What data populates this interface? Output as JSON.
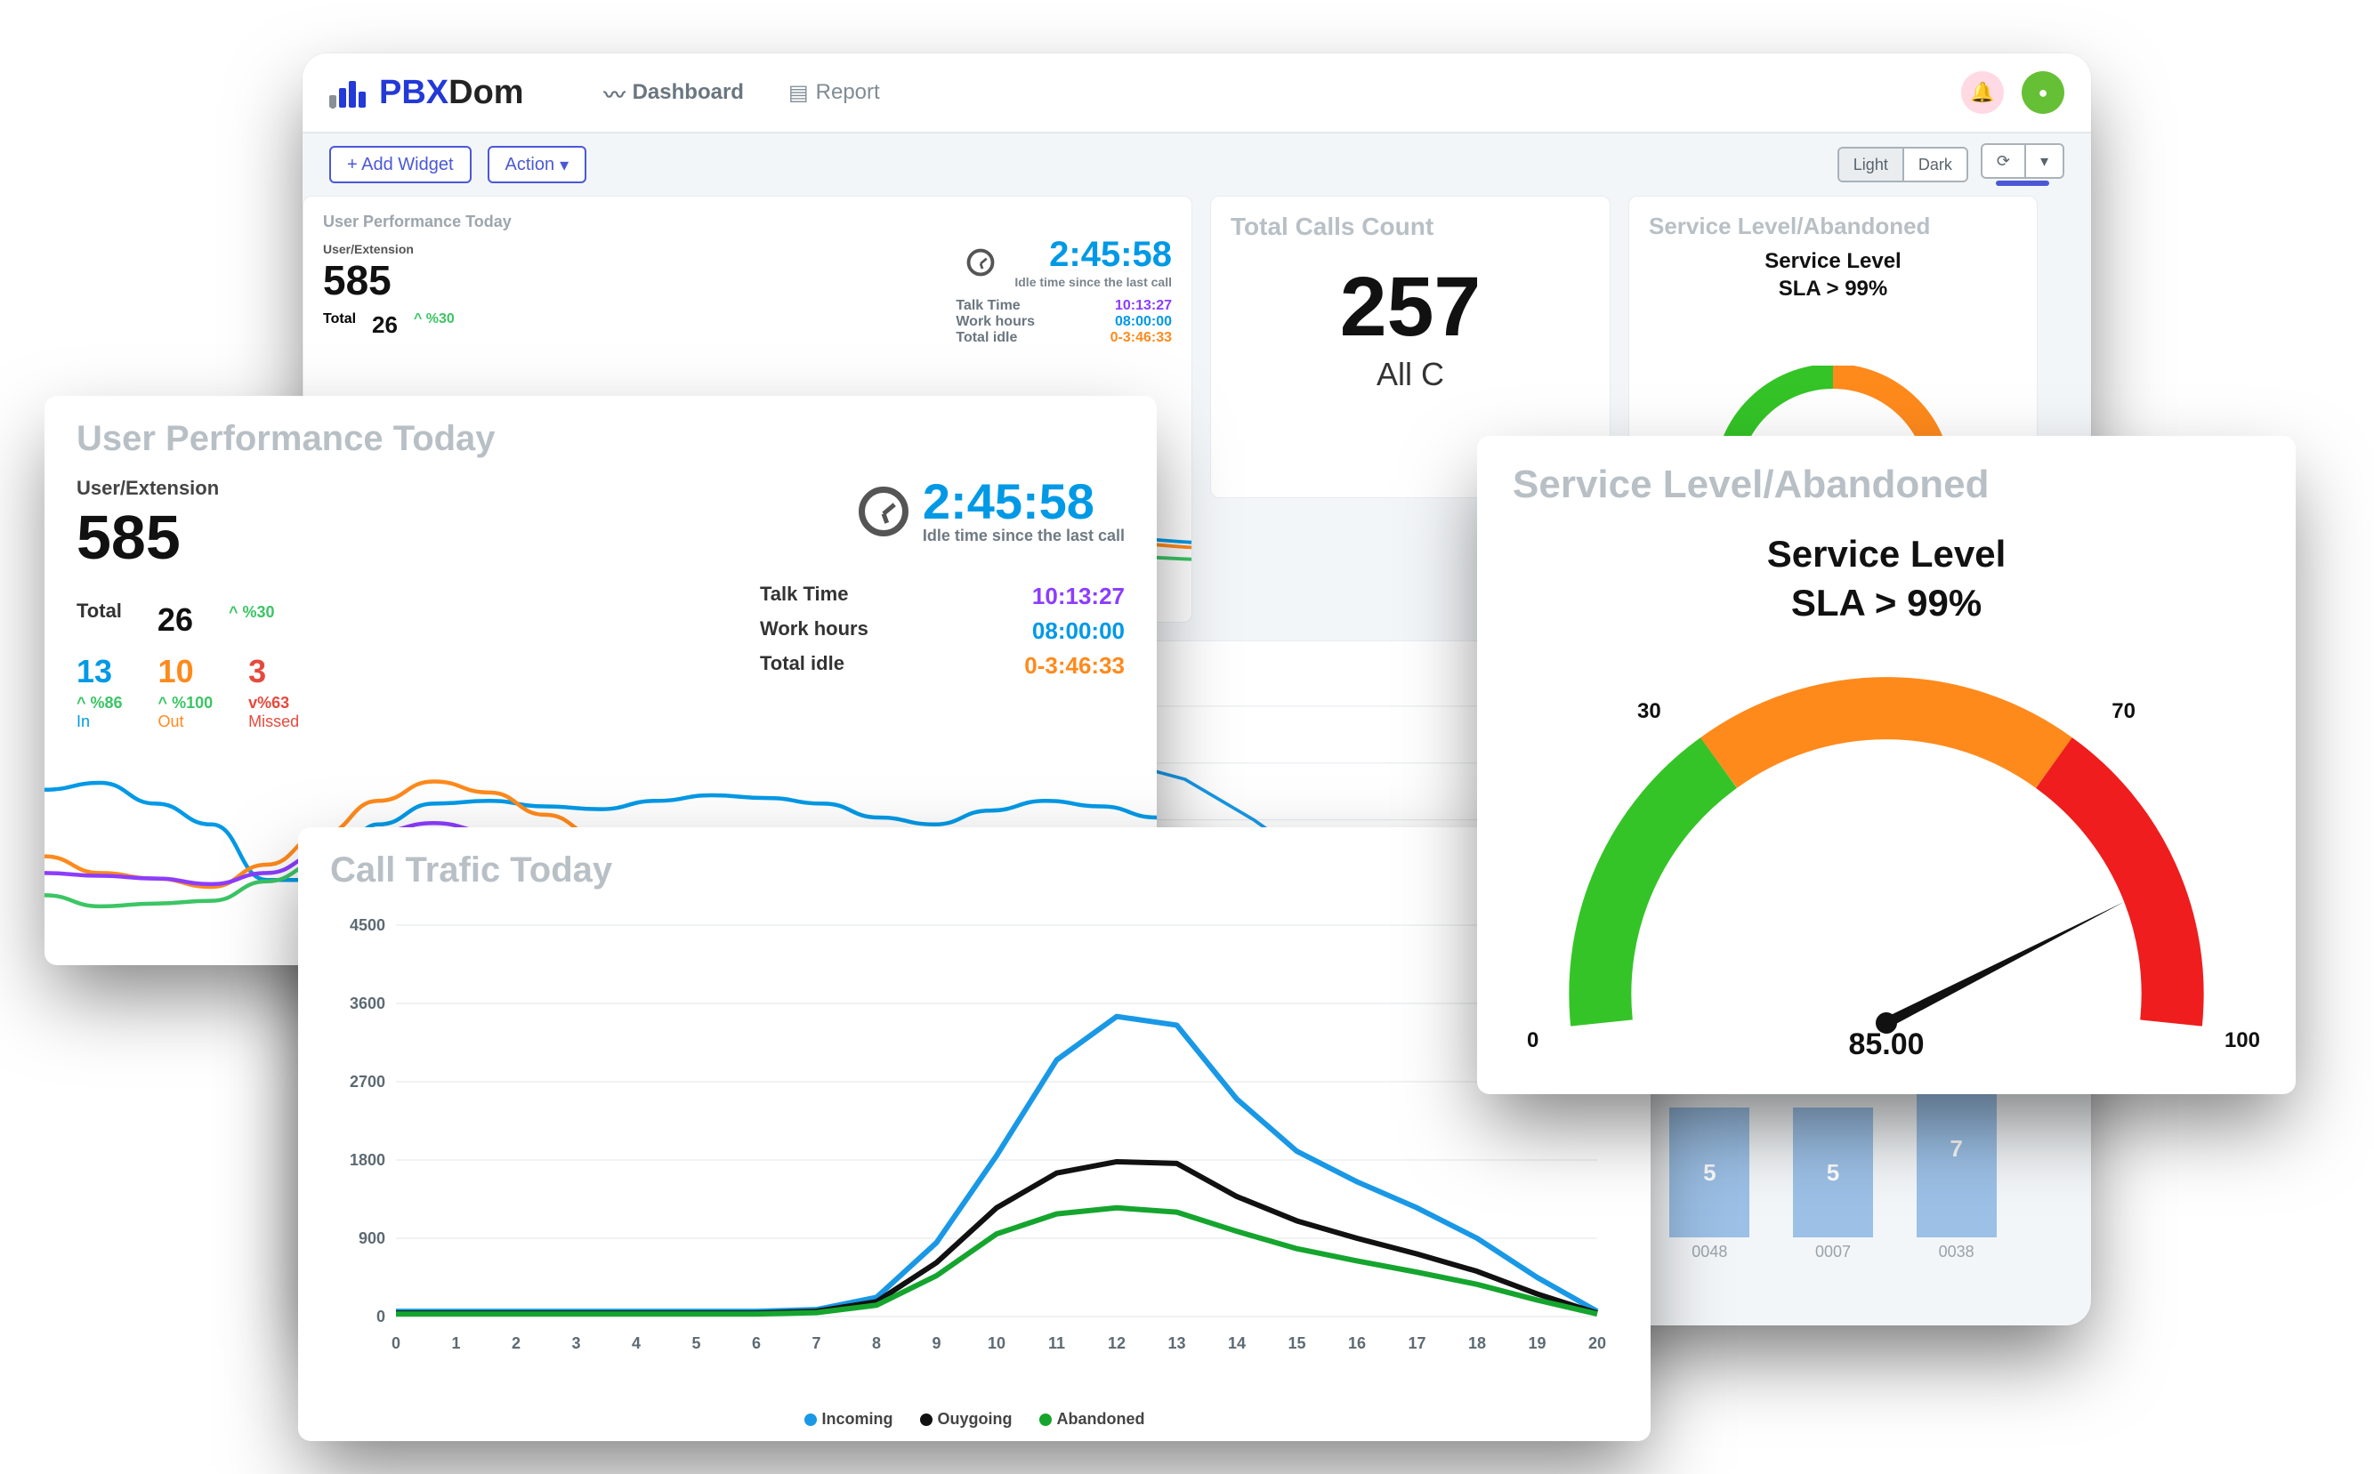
{
  "brand": {
    "prefix": "PBX",
    "suffix": "Dom"
  },
  "nav": {
    "dashboard": "Dashboard",
    "report": "Report"
  },
  "toolbar": {
    "add_widget": "+ Add Widget",
    "action": "Action",
    "light": "Light",
    "dark": "Dark"
  },
  "back_upt": {
    "title": "User Performance Today",
    "user_ext_label": "User/Extension",
    "ext": "585",
    "total_label": "Total",
    "total": "26",
    "pct30": "%30",
    "idle_time": "2:45:58",
    "idle_sub": "Idle time since the last call",
    "talk_label": "Talk Time",
    "talk": "10:13:27",
    "work_label": "Work hours",
    "work": "08:00:00",
    "idle_label": "Total idle",
    "idle": "0-3:46:33"
  },
  "tcc": {
    "title": "Total Calls Count",
    "value_visible": "257",
    "sub_visible": "All C"
  },
  "sla_small": {
    "title": "Service Level/Abandoned",
    "line1": "Service Level",
    "line2": "SLA  >  99%"
  },
  "bars": {
    "items": [
      {
        "value": 5,
        "label": "0048"
      },
      {
        "value": 5,
        "label": "0007"
      },
      {
        "value": 7,
        "label": "0038"
      }
    ]
  },
  "float_upt": {
    "title": "User Performance Today",
    "user_ext_label": "User/Extension",
    "ext": "585",
    "idle_time": "2:45:58",
    "idle_sub": "Idle time since the last call",
    "total_label": "Total",
    "total_value": "26",
    "total_pct": "%30",
    "in_value": "13",
    "in_pct": "%86",
    "in_label": "In",
    "out_value": "10",
    "out_pct": "%100",
    "out_label": "Out",
    "miss_value": "3",
    "miss_pct": "%63",
    "miss_label": "Missed",
    "talk_label": "Talk Time",
    "talk": "10:13:27",
    "work_label": "Work hours",
    "work": "08:00:00",
    "idle_label": "Total idle",
    "idle": "0-3:46:33"
  },
  "float_sla": {
    "title": "Service Level/Abandoned",
    "line1": "Service Level",
    "line2": "SLA  >  99%",
    "value": "85.00",
    "tick0": "0",
    "tick30": "30",
    "tick70": "70",
    "tick100": "100"
  },
  "float_ct": {
    "title": "Call Trafic Today",
    "legend_in": "Incoming",
    "legend_out": "Ouygoing",
    "legend_ab": "Abandoned"
  },
  "chart_data": [
    {
      "type": "line",
      "title": "Call Trafic Today",
      "xlabel": "",
      "ylabel": "",
      "ylim": [
        0,
        4500
      ],
      "x": [
        0,
        1,
        2,
        3,
        4,
        5,
        6,
        7,
        8,
        9,
        10,
        11,
        12,
        13,
        14,
        15,
        16,
        17,
        18,
        19,
        20
      ],
      "yticks": [
        0,
        900,
        1800,
        2700,
        3600,
        4500
      ],
      "series": [
        {
          "name": "Incoming",
          "color": "#1998e6",
          "values": [
            60,
            60,
            60,
            60,
            60,
            60,
            60,
            80,
            220,
            850,
            1850,
            2950,
            3450,
            3350,
            2500,
            1900,
            1550,
            1250,
            900,
            450,
            60
          ]
        },
        {
          "name": "Ouygoing",
          "color": "#111111",
          "values": [
            40,
            40,
            40,
            40,
            40,
            40,
            40,
            60,
            170,
            620,
            1250,
            1650,
            1780,
            1760,
            1380,
            1100,
            900,
            720,
            520,
            260,
            40
          ]
        },
        {
          "name": "Abandoned",
          "color": "#15a52e",
          "values": [
            30,
            30,
            30,
            30,
            30,
            30,
            30,
            45,
            130,
            470,
            950,
            1180,
            1250,
            1200,
            980,
            780,
            640,
            510,
            370,
            190,
            30
          ]
        }
      ]
    },
    {
      "type": "gauge",
      "title": "Service Level/Abandoned",
      "range": [
        0,
        100
      ],
      "bands": [
        {
          "from": 0,
          "to": 30,
          "color": "#34c427"
        },
        {
          "from": 30,
          "to": 70,
          "color": "#ff8a1c"
        },
        {
          "from": 70,
          "to": 100,
          "color": "#ef1d1d"
        }
      ],
      "value": 85.0
    },
    {
      "type": "bar",
      "categories": [
        "0048",
        "0007",
        "0038"
      ],
      "values": [
        5,
        5,
        7
      ],
      "color": "#9cc0e6"
    },
    {
      "type": "line",
      "title": "User Performance sparkline",
      "x": [
        0,
        1,
        2,
        3,
        4,
        5,
        6,
        7,
        8,
        9,
        10,
        11,
        12,
        13,
        14,
        15,
        16,
        17,
        18,
        19,
        20
      ],
      "series": [
        {
          "name": "blue",
          "color": "#0099e6",
          "values": [
            120,
            125,
            110,
            95,
            55,
            55,
            95,
            110,
            112,
            108,
            106,
            112,
            116,
            114,
            110,
            100,
            95,
            105,
            112,
            108,
            100
          ]
        },
        {
          "name": "orange",
          "color": "#ff8a1c",
          "values": [
            72,
            60,
            56,
            50,
            66,
            88,
            112,
            126,
            118,
            102,
            86,
            76,
            80,
            82,
            72,
            60,
            52,
            62,
            78,
            70,
            60
          ]
        },
        {
          "name": "purple",
          "color": "#8c3dff",
          "values": [
            60,
            58,
            56,
            52,
            60,
            74,
            90,
            96,
            90,
            82,
            74,
            70,
            76,
            82,
            76,
            64,
            58,
            64,
            72,
            66,
            58
          ]
        },
        {
          "name": "green",
          "color": "#3cc565",
          "values": [
            44,
            36,
            38,
            40,
            54,
            68,
            78,
            84,
            80,
            72,
            60,
            54,
            62,
            70,
            64,
            52,
            44,
            50,
            58,
            52,
            44
          ]
        }
      ]
    }
  ]
}
